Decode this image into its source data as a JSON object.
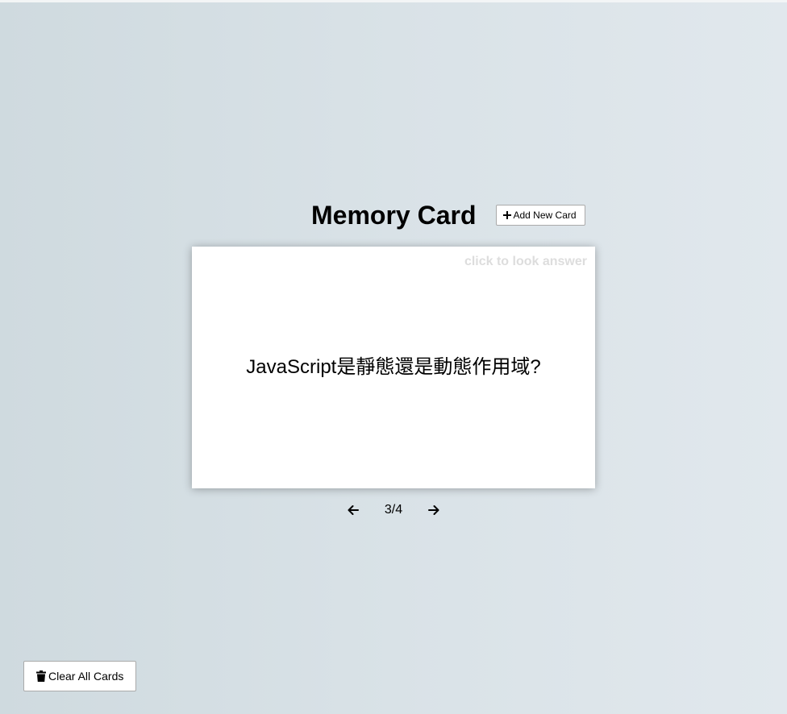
{
  "header": {
    "title": "Memory Card",
    "add_button_label": "Add New Card",
    "add_icon": "plus-icon"
  },
  "card": {
    "hint": "click to look answer",
    "question": "JavaScript是靜態還是動態作用域?"
  },
  "navigation": {
    "prev_icon": "arrow-left-icon",
    "next_icon": "arrow-right-icon",
    "counter": "3/4"
  },
  "footer": {
    "clear_button_label": "Clear All Cards",
    "clear_icon": "trash-icon"
  }
}
